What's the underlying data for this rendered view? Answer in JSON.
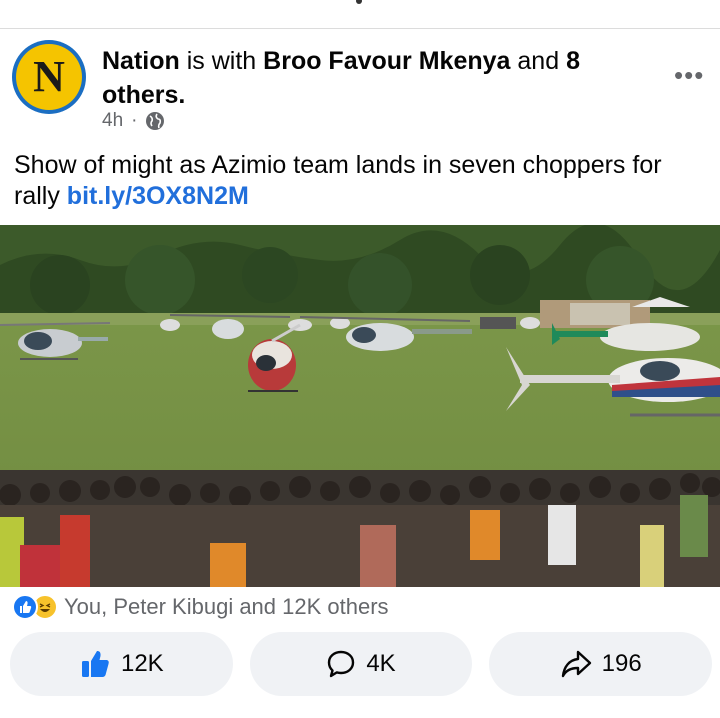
{
  "post": {
    "author_name": "Nation",
    "with_text": "is with",
    "tagged_name": "Broo Favour Mkenya",
    "and_text": "and",
    "others_text": "8 others",
    "time": "4h",
    "separator": "·",
    "avatar_letter": "N",
    "more_label": "•••",
    "caption_text": "Show of might as Azimio team lands in seven choppers for rally",
    "caption_link": "bit.ly/3OX8N2M"
  },
  "reactions": {
    "summary": "You, Peter Kibugi and 12K others"
  },
  "actions": {
    "like_count": "12K",
    "comment_count": "4K",
    "share_count": "196"
  },
  "colors": {
    "link": "#216fdb",
    "like_blue": "#1877f2",
    "button_bg": "#f0f2f5",
    "muted": "#65676b"
  }
}
